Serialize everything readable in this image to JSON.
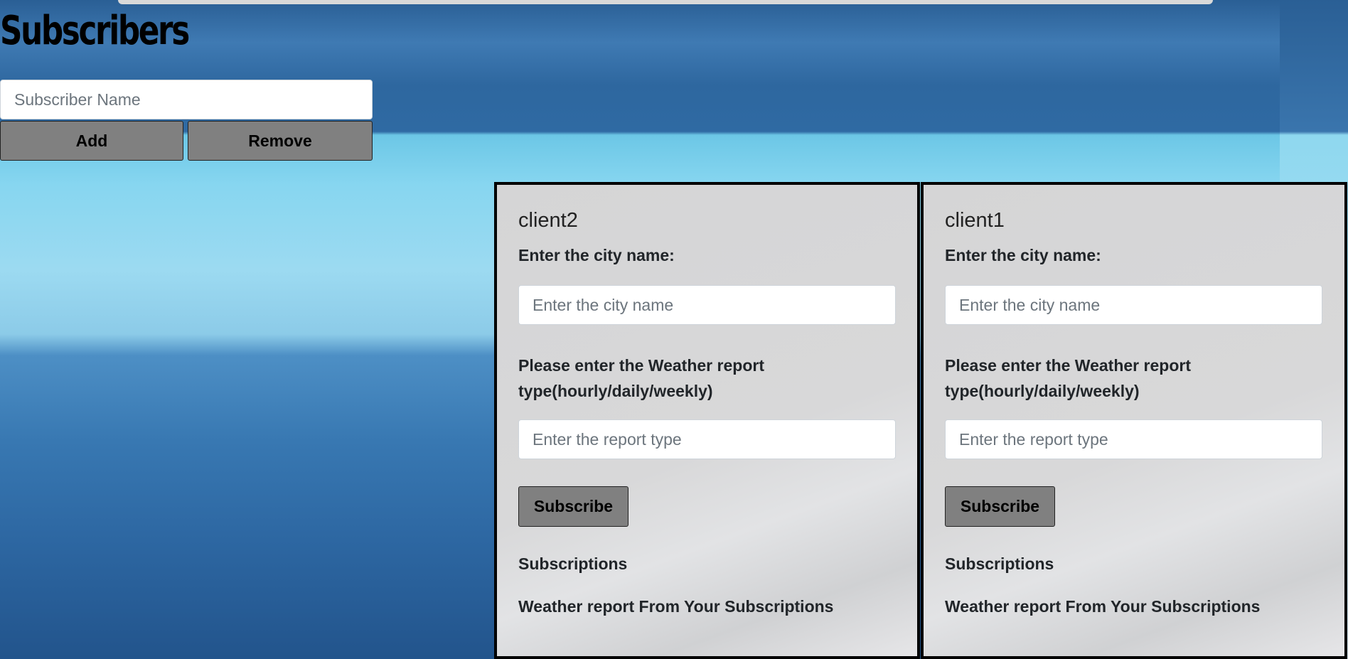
{
  "page": {
    "title": "Subscribers"
  },
  "subscriber_form": {
    "name_placeholder": "Subscriber Name",
    "name_value": "",
    "add_label": "Add",
    "remove_label": "Remove"
  },
  "clients": [
    {
      "name": "client2",
      "city_label": "Enter the city name:",
      "city_placeholder": "Enter the city name",
      "report_label": "Please enter the Weather report type(hourly/daily/weekly)",
      "report_placeholder": "Enter the report type",
      "subscribe_label": "Subscribe",
      "subscriptions_heading": "Subscriptions",
      "weather_heading": "Weather report From Your Subscriptions"
    },
    {
      "name": "client1",
      "city_label": "Enter the city name:",
      "city_placeholder": "Enter the city name",
      "report_label": "Please enter the Weather report type(hourly/daily/weekly)",
      "report_placeholder": "Enter the report type",
      "subscribe_label": "Subscribe",
      "subscriptions_heading": "Subscriptions",
      "weather_heading": "Weather report From Your Subscriptions"
    }
  ],
  "colors": {
    "button_gray": "#808080",
    "card_border": "#000000",
    "card_bg": "#d8d8d9"
  }
}
